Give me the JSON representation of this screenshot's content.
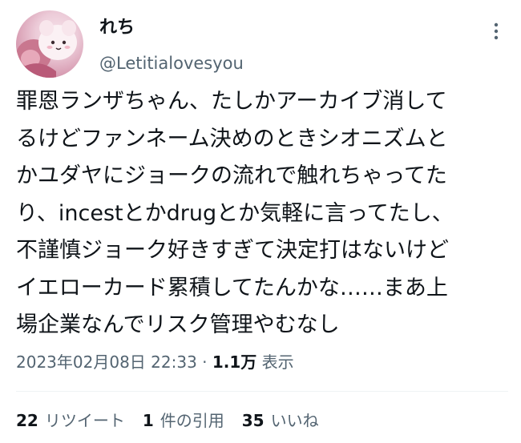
{
  "author": {
    "name": "れち",
    "handle": "@Letitialovesyou"
  },
  "tweet": {
    "text": "罪恩ランザちゃん、たしかアーカイブ消して\nるけどファンネーム決めのときシオニズムと\nかユダヤにジョークの流れで触れちゃってた\nり、incestとかdrugとか気軽に言ってたし、\n不謹慎ジョーク好きすぎて決定打はないけど\nイエローカード累積してたんかな……まあ上\n場企業なんでリスク管理やむなし"
  },
  "meta": {
    "timestamp": "2023年02月08日 22:33",
    "separator": "·",
    "views_count": "1.1万",
    "views_label": "表示"
  },
  "stats": {
    "retweets_count": "22",
    "retweets_label": "リツイート",
    "quotes_count": "1",
    "quotes_label": "件の引用",
    "likes_count": "35",
    "likes_label": "いいね"
  },
  "icons": {
    "more": "more-vertical-icon"
  }
}
